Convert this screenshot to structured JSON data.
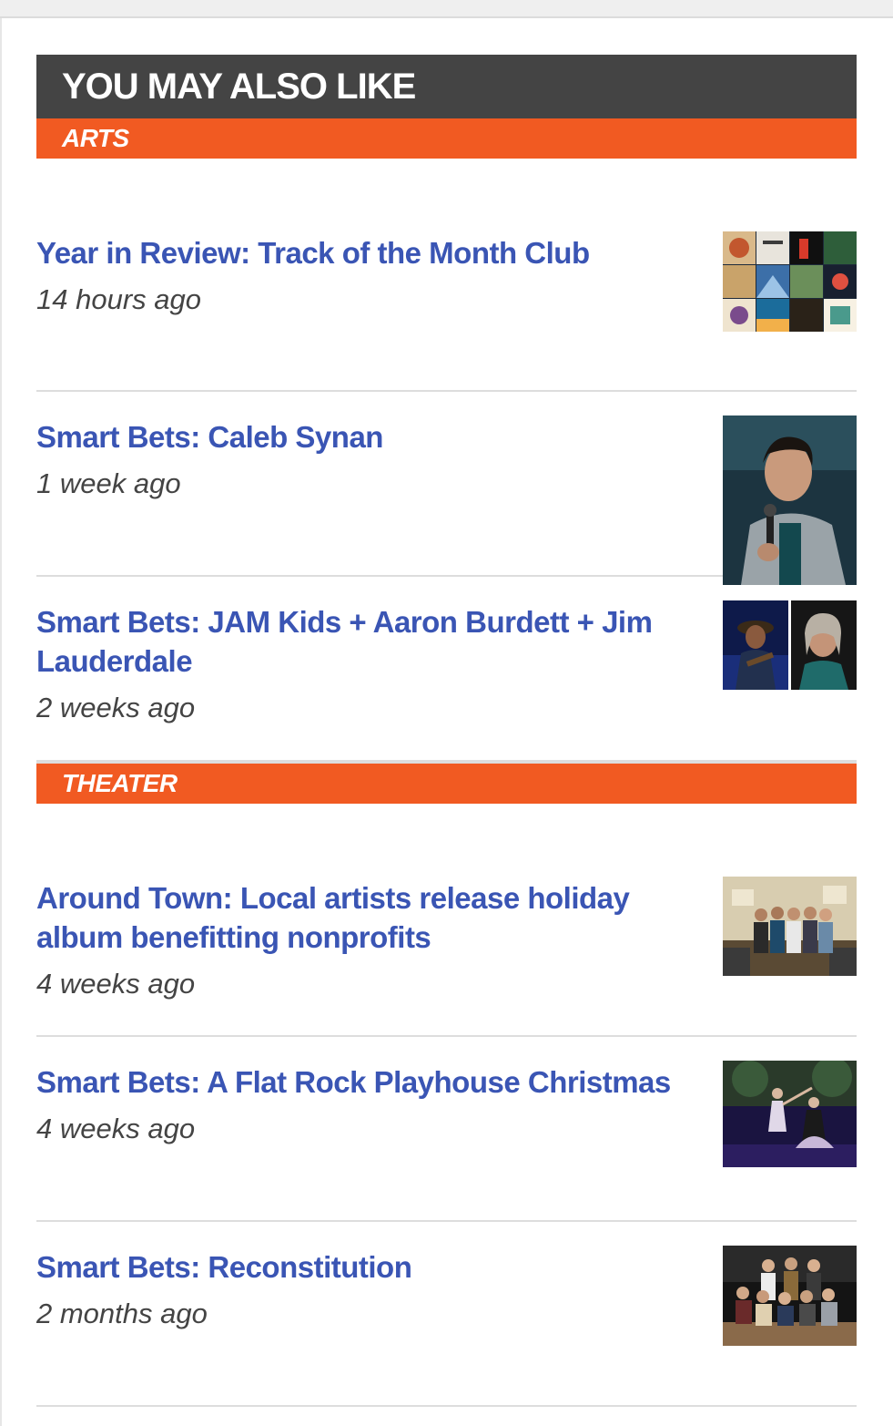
{
  "module": {
    "title": "YOU MAY ALSO LIKE"
  },
  "sections": [
    {
      "label": "ARTS",
      "items": [
        {
          "title": "Year in Review: Track of the Month Club",
          "time": "14 hours ago",
          "thumb": "album-collage-thumbnail"
        },
        {
          "title": "Smart Bets: Caleb Synan",
          "time": "1 week ago",
          "thumb": "comedian-with-microphone-thumbnail"
        },
        {
          "title": "Smart Bets: JAM Kids + Aaron Burdett + Jim Lauderdale",
          "time": "2 weeks ago",
          "thumb": "musicians-portraits-thumbnail"
        }
      ]
    },
    {
      "label": "THEATER",
      "items": [
        {
          "title": "Around Town: Local artists release holiday album benefitting nonprofits",
          "time": "4 weeks ago",
          "thumb": "group-photo-studio-thumbnail"
        },
        {
          "title": "Smart Bets: A Flat Rock Playhouse Christmas",
          "time": "4 weeks ago",
          "thumb": "dancers-stage-thumbnail"
        },
        {
          "title": "Smart Bets: Reconstitution",
          "time": "2 months ago",
          "thumb": "cast-group-photo-thumbnail"
        }
      ]
    }
  ],
  "colors": {
    "header_bg": "#444444",
    "section_bar": "#f15a22",
    "link": "#3a55b4",
    "timestamp": "#444444"
  }
}
